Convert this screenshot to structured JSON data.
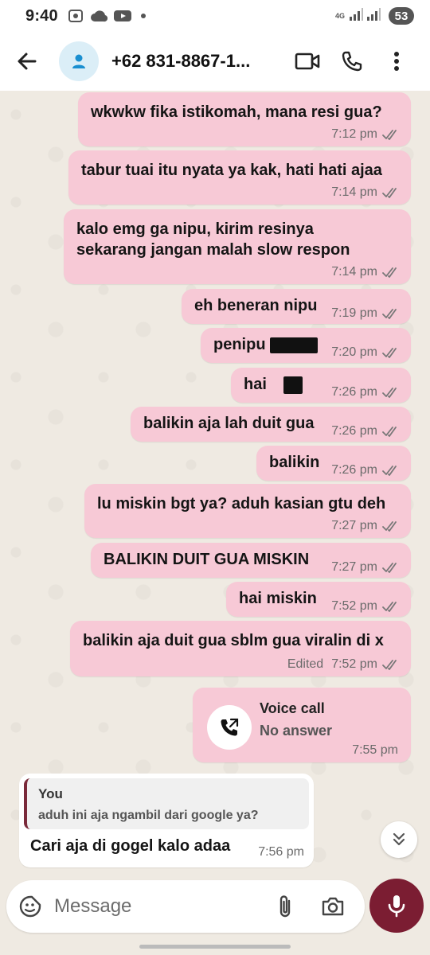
{
  "status_bar": {
    "time": "9:40",
    "network": "4G",
    "battery": "53"
  },
  "header": {
    "contact_name": "+62 831-8867-1...",
    "icons": [
      "back-arrow-icon",
      "person-icon",
      "video-call-icon",
      "phone-icon",
      "more-vert-icon"
    ]
  },
  "messages": [
    {
      "text": "wkwkw fika istikomah, mana resi gua?",
      "time": "7:12 pm"
    },
    {
      "text": "tabur tuai itu nyata ya kak, hati hati ajaa",
      "time": "7:14 pm"
    },
    {
      "text_line1": "kalo emg ga nipu, kirim resinya",
      "text_line2": "sekarang jangan malah slow respon",
      "time": "7:14 pm"
    },
    {
      "text": "eh beneran nipu",
      "time": "7:19 pm"
    },
    {
      "text": "penipu",
      "time": "7:20 pm"
    },
    {
      "text": "hai",
      "time": "7:26 pm"
    },
    {
      "text": "balikin aja lah duit gua",
      "time": "7:26 pm"
    },
    {
      "text": "balikin",
      "time": "7:26 pm"
    },
    {
      "text": "lu miskin bgt ya? aduh kasian gtu deh",
      "time": "7:27 pm"
    },
    {
      "text": "BALIKIN DUIT GUA MISKIN",
      "time": "7:27 pm"
    },
    {
      "text": "hai miskin",
      "time": "7:52 pm"
    },
    {
      "text": "balikin aja duit gua sblm gua viralin di x",
      "time": "7:52 pm",
      "edited": "Edited"
    }
  ],
  "voice_call": {
    "title": "Voice call",
    "subtitle": "No answer",
    "time": "7:55 pm"
  },
  "incoming": {
    "quote_author": "You",
    "quote_text": "aduh ini aja ngambil dari google ya?",
    "text": "Cari aja di gogel kalo adaa",
    "time": "7:56 pm"
  },
  "composer": {
    "placeholder": "Message"
  },
  "colors": {
    "outgoing_bubble": "#f7c9d6",
    "accent": "#7b1d32",
    "chat_background": "#efeae2"
  }
}
